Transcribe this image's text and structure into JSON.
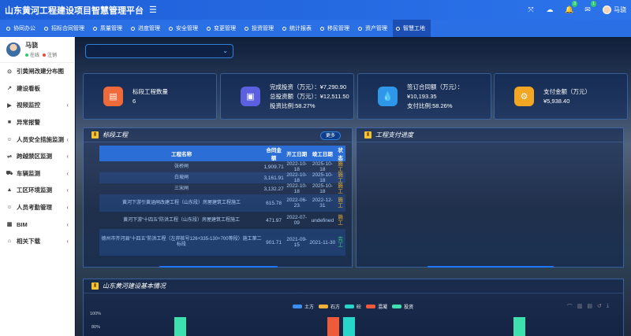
{
  "app": {
    "title": "山东黄河工程建设项目智慧管理平台"
  },
  "topbar": {
    "notif_count": "3",
    "msg_count": "1",
    "user_name": "马骁"
  },
  "nav": {
    "items": [
      "协同办公",
      "招标合同管理",
      "质量管理",
      "进度管理",
      "安全管理",
      "变更管理",
      "投资管理",
      "统计报表",
      "移民管理",
      "资产管理",
      "智慧工地"
    ],
    "active_index": 10
  },
  "sidebar": {
    "user": {
      "name": "马骁",
      "online": "在线",
      "logout": "注销"
    },
    "items": [
      {
        "label": "引黄闸改建分布图",
        "icon": "location-icon",
        "chevron": false
      },
      {
        "label": "建设看板",
        "icon": "trend-icon",
        "chevron": false
      },
      {
        "label": "视频监控",
        "icon": "camera-icon",
        "chevron": true
      },
      {
        "label": "异常报警",
        "icon": "alarm-icon",
        "chevron": false
      },
      {
        "label": "人员安全措施监测",
        "icon": "person-icon",
        "chevron": true
      },
      {
        "label": "跨越禁区监测",
        "icon": "barrier-icon",
        "chevron": true
      },
      {
        "label": "车辆监测",
        "icon": "truck-icon",
        "chevron": true
      },
      {
        "label": "工区环境监测",
        "icon": "environment-icon",
        "chevron": true
      },
      {
        "label": "人员考勤管理",
        "icon": "person-icon",
        "chevron": true
      },
      {
        "label": "BIM",
        "icon": "bim-icon",
        "chevron": true
      },
      {
        "label": "相关下载",
        "icon": "download-icon",
        "chevron": true
      }
    ]
  },
  "stats": [
    {
      "label": "标段工程数量",
      "value": "6",
      "color": "#ee6a3b"
    },
    {
      "line1": "完成投资（万元）：¥7,290.90",
      "line2": "总投资额（万元）：¥12,511.50",
      "line3": "投资比例:58.27%",
      "color": "#5b5fe0"
    },
    {
      "line1": "签订合同额（万元）：",
      "line2": "¥10,193.35",
      "line3": "支付比例:58.26%",
      "color": "#2f97ea"
    },
    {
      "line1": "支付金额（万元）",
      "line2": "¥5,938.40",
      "color": "#f2a623"
    }
  ],
  "sections": {
    "projects_title": "标段工程",
    "more_label": "更多",
    "progress_title": "工程支付进度",
    "overview_title": "山东黄河建设基本情况"
  },
  "table": {
    "headers": [
      "工程名称",
      "合同金额",
      "开工日期",
      "竣工日期",
      "状态"
    ],
    "rows": [
      {
        "name": "张桥闸",
        "amount": "1,909.71",
        "start": "2022-10-18",
        "end": "2025-10-18",
        "status": "施工"
      },
      {
        "name": "白坡闸",
        "amount": "3,161.91",
        "start": "2022-10-18",
        "end": "2025-10-18",
        "status": "施工"
      },
      {
        "name": "三宋闸",
        "amount": "3,132.27",
        "start": "2022-10-18",
        "end": "2025-10-18",
        "status": "施工"
      },
      {
        "name": "黄河下游引黄涵闸改建工程（山东段）房屋建筑工程施工",
        "amount": "615.78",
        "start": "2022-06-23",
        "end": "2022-12-31",
        "status": "施工"
      },
      {
        "name": "黄河下游“十四五”防洪工程（山东段）房屋建筑工程施工",
        "amount": "471.97",
        "start": "2022-07-09",
        "end": "undefined",
        "status": "施工"
      },
      {
        "name": "德州市齐河县“十四五”防洪工程（左岸桩号126+335-130+700等段）施工第二标段",
        "amount": "901.71",
        "start": "2021-09-15",
        "end": "2021-11-30",
        "status": "完工"
      }
    ]
  },
  "chart_data": {
    "type": "bar",
    "legend": [
      "土方",
      "石方",
      "砼",
      "混凝",
      "投资"
    ],
    "colors": [
      "#3b8ff0",
      "#f2b23a",
      "#26d6c9",
      "#ee5a3a",
      "#3ee0b0"
    ],
    "yticks": [
      "100%",
      "80%"
    ],
    "visible_bars": [
      {
        "series": "投资",
        "value": 100
      },
      {
        "series": "混凝",
        "value": 100
      },
      {
        "series": "砼",
        "value": 100
      },
      {
        "series": "投资",
        "value": 100
      }
    ]
  }
}
